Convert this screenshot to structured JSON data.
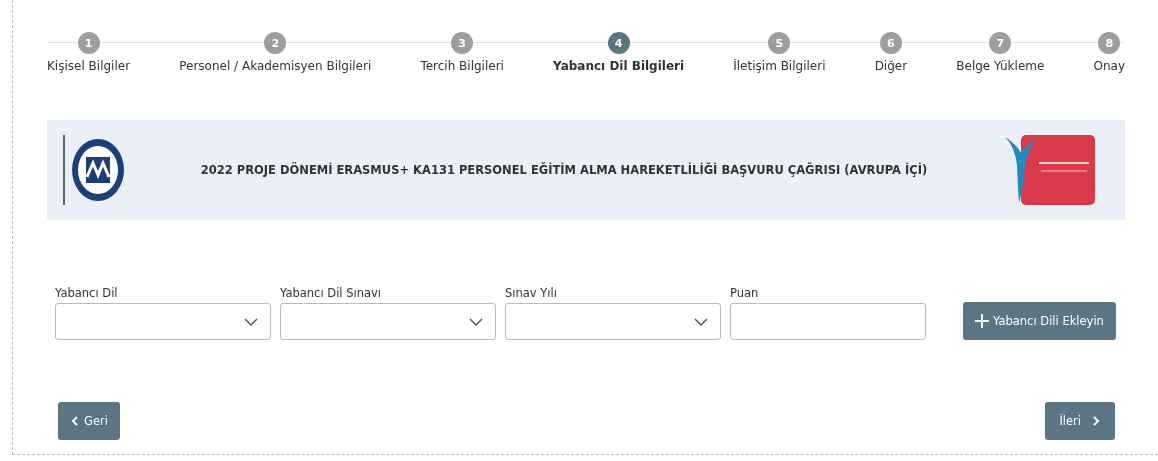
{
  "steps": [
    {
      "number": "1",
      "label": "Kişisel Bilgiler",
      "selected": false
    },
    {
      "number": "2",
      "label": "Personel / Akademisyen Bilgileri",
      "selected": false
    },
    {
      "number": "3",
      "label": "Tercih Bilgileri",
      "selected": false
    },
    {
      "number": "4",
      "label": "Yabancı Dil Bilgileri",
      "selected": true
    },
    {
      "number": "5",
      "label": "İletişim Bilgileri",
      "selected": false
    },
    {
      "number": "6",
      "label": "Diğer",
      "selected": false
    },
    {
      "number": "7",
      "label": "Belge Yükleme",
      "selected": false
    },
    {
      "number": "8",
      "label": "Onay",
      "selected": false
    }
  ],
  "banner": {
    "title": "2022 PROJE DÖNEMİ ERASMUS+ KA131 PERSONEL EĞİTİM ALMA HAREKETLİLİĞİ BAŞVURU ÇAĞRISI (AVRUPA İÇİ)"
  },
  "fields": [
    {
      "label": "Yabancı Dil",
      "kind": "select"
    },
    {
      "label": "Yabancı Dil Sınavı",
      "kind": "select"
    },
    {
      "label": "Sınav Yılı",
      "kind": "select"
    },
    {
      "label": "Puan",
      "kind": "text"
    }
  ],
  "add_button": {
    "label": "Yabancı Dili Ekleyin"
  },
  "nav": {
    "back": "Geri",
    "next": "İleri"
  }
}
